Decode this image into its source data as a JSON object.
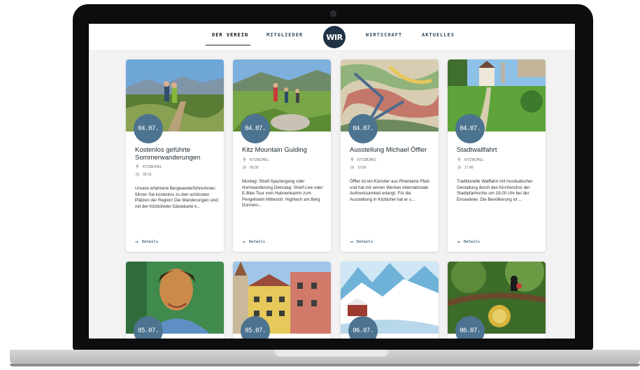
{
  "nav": {
    "items": [
      "DER VEREIN",
      "MITGLIEDER",
      "WIRTSCHAFT",
      "AKTUELLES"
    ],
    "logo": "WIR"
  },
  "cards": [
    {
      "date": "04.07.",
      "title": "Kostenlos geführte Sommerwanderungen",
      "location": "KITZBÜHEL",
      "time": "09:15",
      "text": "Unsere erfahrene Bergwanderführerinnen führen Sie kostenlos zu den schönsten Plätzen der Region! Die Wanderungen sind mit der Kitzbüheler Gästekarte k...",
      "details": "Details"
    },
    {
      "date": "04.07.",
      "title": "Kitz Mountain Guiding",
      "location": "KITZBÜHEL",
      "time": "09:30",
      "text": "Montag: Streif-Spaziergang oder Hornwanderung Dienstag: Streif-Live oder E-Bike Tour vom Hahnenkamm zum Pengelstein Mittwoch: Hightech am Berg Donners...",
      "details": "Details"
    },
    {
      "date": "04.07.",
      "title": "Ausstellung Michael Öffler",
      "location": "KITZBÜHEL",
      "time": "10:00",
      "text": "Öffler ist ein Künstler aus Rheinland Pfalz und hat mit seinen Werken internationale Aufmerksamkeit erlangt. Für die Ausstellung in Kitzbühel hat er s...",
      "details": "Details"
    },
    {
      "date": "04.07.",
      "title": "Stadtwallfahrt",
      "location": "KITZBÜHEL",
      "time": "17:45",
      "text": "Traditionelle Wallfahrt mit musikalischer Gestaltung durch den Kirchenchor der Stadtpfarrkirche um 19.00 Uhr bei der Einsiedelei. Die Bevölkerung ist ...",
      "details": "Details"
    }
  ],
  "cards_row2": [
    {
      "date": "05.07."
    },
    {
      "date": "05.07."
    },
    {
      "date": "06.07."
    },
    {
      "date": "06.07."
    }
  ]
}
